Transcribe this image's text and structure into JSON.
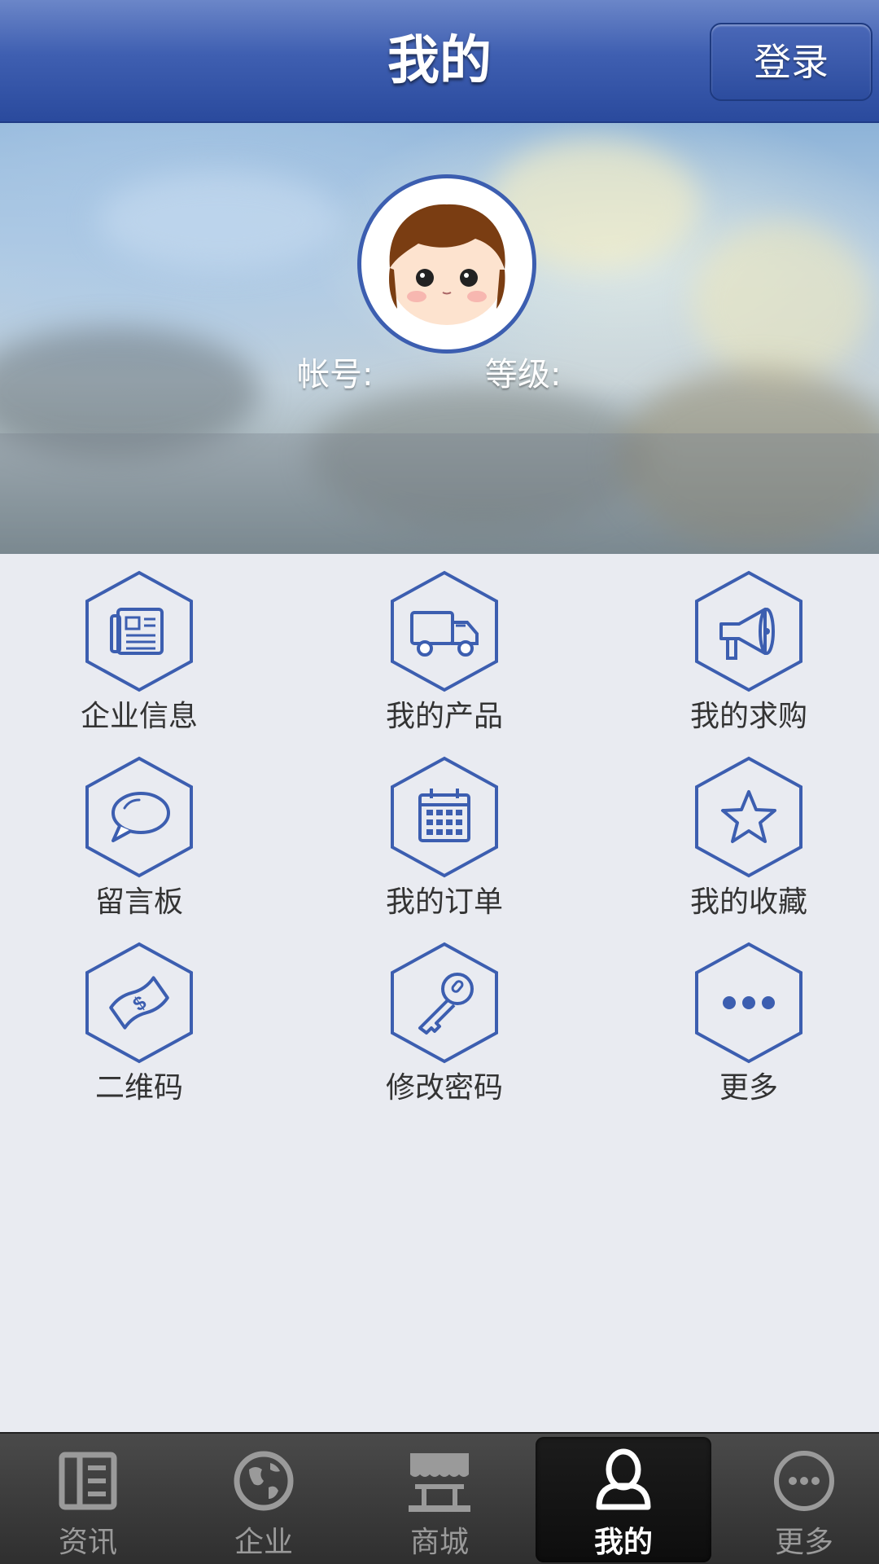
{
  "header": {
    "title": "我的",
    "login_label": "登录"
  },
  "account": {
    "account_label": "帐号:",
    "level_label": "等级:"
  },
  "grid": [
    {
      "label": "企业信息",
      "icon": "newspaper-icon"
    },
    {
      "label": "我的产品",
      "icon": "truck-icon"
    },
    {
      "label": "我的求购",
      "icon": "megaphone-icon"
    },
    {
      "label": "留言板",
      "icon": "speech-bubble-icon"
    },
    {
      "label": "我的订单",
      "icon": "calendar-icon"
    },
    {
      "label": "我的收藏",
      "icon": "star-icon"
    },
    {
      "label": "二维码",
      "icon": "money-bill-icon"
    },
    {
      "label": "修改密码",
      "icon": "key-icon"
    },
    {
      "label": "更多",
      "icon": "more-dots-icon"
    }
  ],
  "tabs": [
    {
      "label": "资讯",
      "icon": "news-icon",
      "active": false
    },
    {
      "label": "企业",
      "icon": "globe-icon",
      "active": false
    },
    {
      "label": "商城",
      "icon": "store-icon",
      "active": false
    },
    {
      "label": "我的",
      "icon": "person-icon",
      "active": true
    },
    {
      "label": "更多",
      "icon": "more-icon",
      "active": false
    }
  ],
  "colors": {
    "accent": "#3c5eb0",
    "header": "#3f5fb1",
    "tabbar": "#2f2f2f"
  }
}
